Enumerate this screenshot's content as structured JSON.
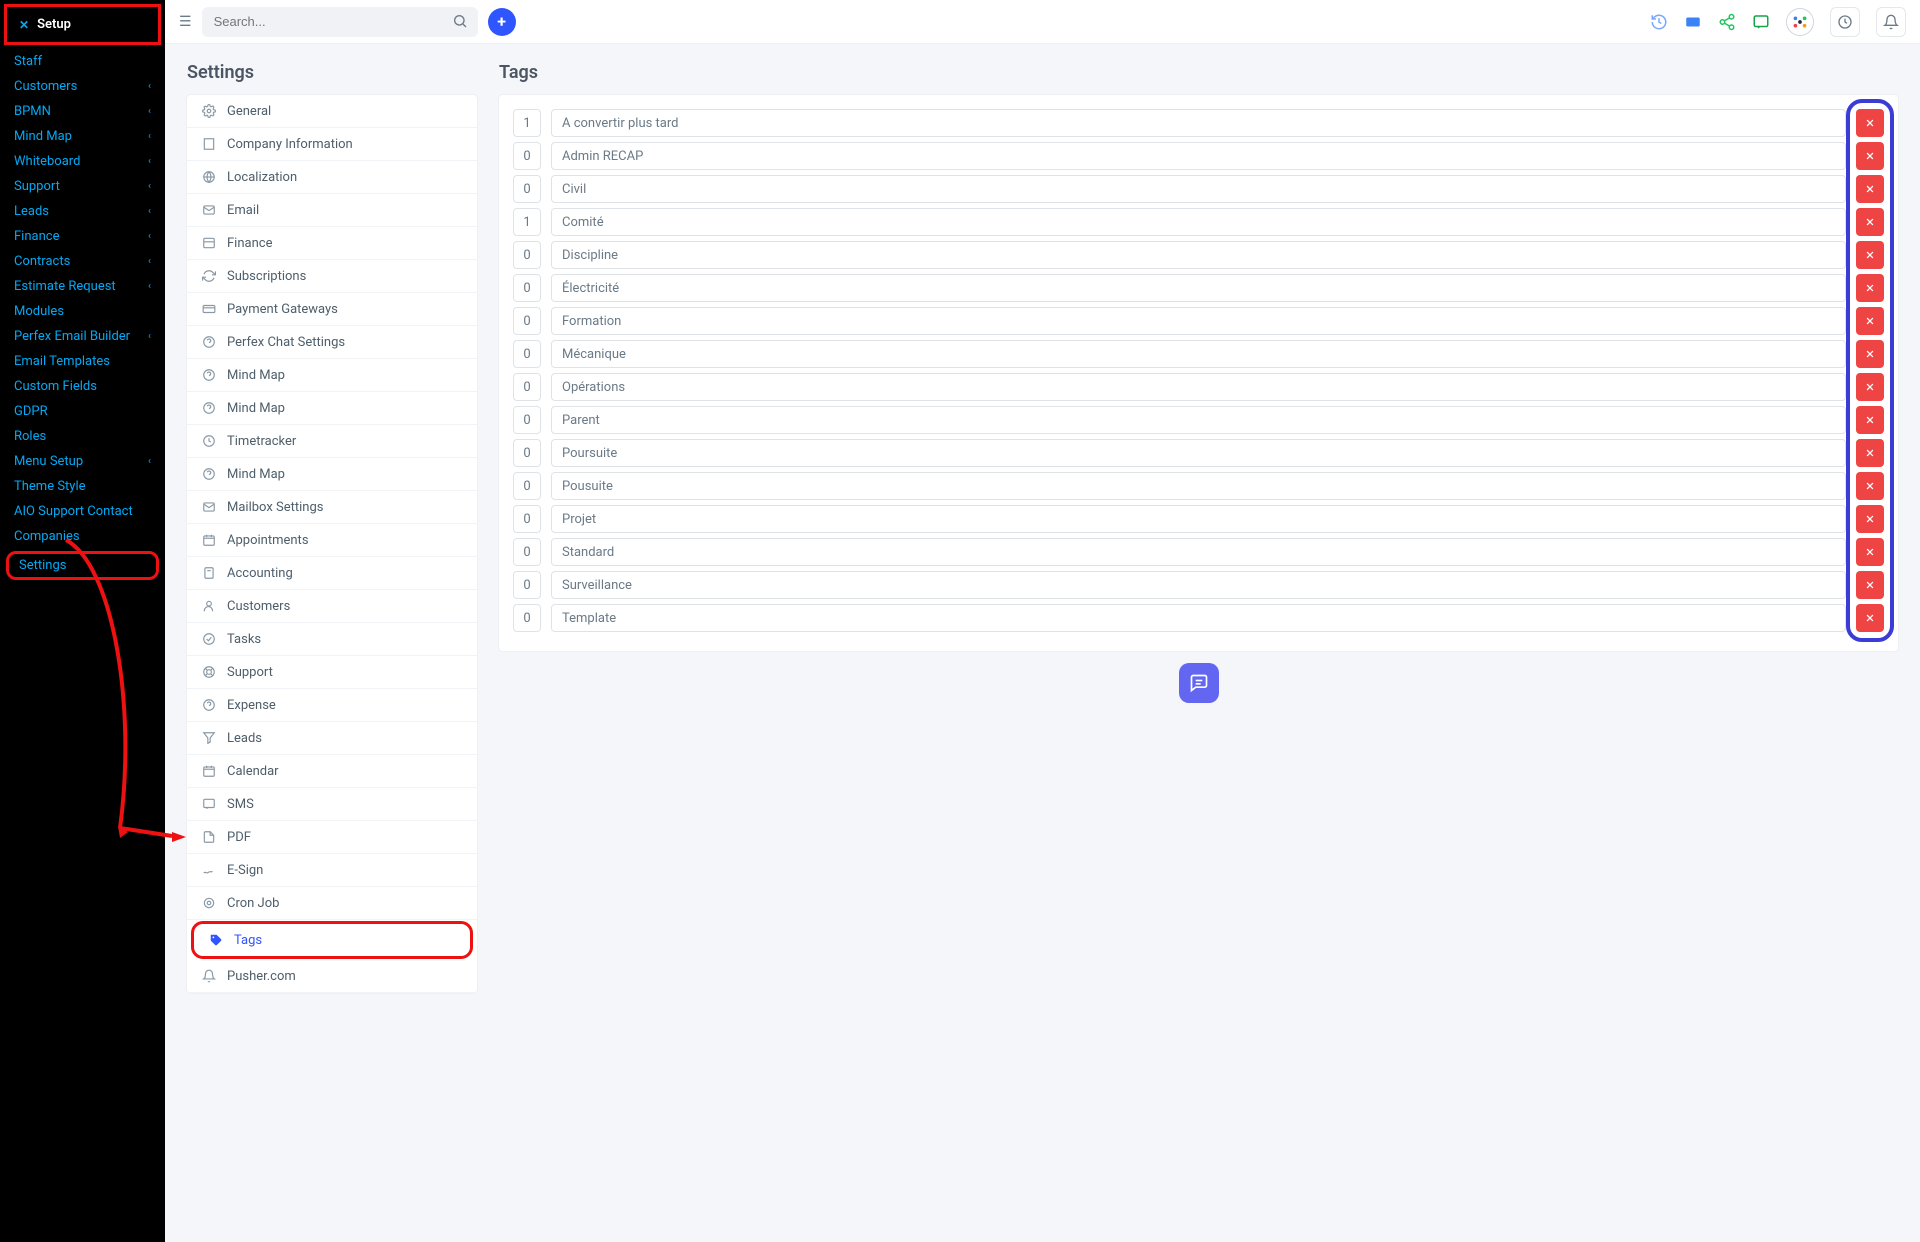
{
  "sidebar": {
    "title": "Setup",
    "items": [
      {
        "label": "Staff",
        "expandable": false
      },
      {
        "label": "Customers",
        "expandable": true
      },
      {
        "label": "BPMN",
        "expandable": true
      },
      {
        "label": "Mind Map",
        "expandable": true
      },
      {
        "label": "Whiteboard",
        "expandable": true
      },
      {
        "label": "Support",
        "expandable": true
      },
      {
        "label": "Leads",
        "expandable": true
      },
      {
        "label": "Finance",
        "expandable": true
      },
      {
        "label": "Contracts",
        "expandable": true
      },
      {
        "label": "Estimate Request",
        "expandable": true
      },
      {
        "label": "Modules",
        "expandable": false
      },
      {
        "label": "Perfex Email Builder",
        "expandable": true
      },
      {
        "label": "Email Templates",
        "expandable": false
      },
      {
        "label": "Custom Fields",
        "expandable": false
      },
      {
        "label": "GDPR",
        "expandable": false
      },
      {
        "label": "Roles",
        "expandable": false
      },
      {
        "label": "Menu Setup",
        "expandable": true
      },
      {
        "label": "Theme Style",
        "expandable": false
      },
      {
        "label": "AIO Support Contact",
        "expandable": false
      },
      {
        "label": "Companies",
        "expandable": false
      },
      {
        "label": "Settings",
        "expandable": false,
        "highlight": true
      }
    ]
  },
  "topbar": {
    "search_placeholder": "Search..."
  },
  "settings_panel": {
    "title": "Settings",
    "items": [
      {
        "icon": "gear",
        "label": "General"
      },
      {
        "icon": "building",
        "label": "Company Information"
      },
      {
        "icon": "globe",
        "label": "Localization"
      },
      {
        "icon": "mail",
        "label": "Email"
      },
      {
        "icon": "finance",
        "label": "Finance"
      },
      {
        "icon": "refresh",
        "label": "Subscriptions"
      },
      {
        "icon": "card",
        "label": "Payment Gateways"
      },
      {
        "icon": "help",
        "label": "Perfex Chat Settings"
      },
      {
        "icon": "help",
        "label": "Mind Map"
      },
      {
        "icon": "help",
        "label": "Mind Map"
      },
      {
        "icon": "clock",
        "label": "Timetracker"
      },
      {
        "icon": "help",
        "label": "Mind Map"
      },
      {
        "icon": "mail",
        "label": "Mailbox Settings"
      },
      {
        "icon": "calendar",
        "label": "Appointments"
      },
      {
        "icon": "calc",
        "label": "Accounting"
      },
      {
        "icon": "user",
        "label": "Customers"
      },
      {
        "icon": "check",
        "label": "Tasks"
      },
      {
        "icon": "lifebuoy",
        "label": "Support"
      },
      {
        "icon": "help",
        "label": "Expense"
      },
      {
        "icon": "leads",
        "label": "Leads"
      },
      {
        "icon": "calendar",
        "label": "Calendar"
      },
      {
        "icon": "sms",
        "label": "SMS"
      },
      {
        "icon": "pdf",
        "label": "PDF"
      },
      {
        "icon": "sign",
        "label": "E-Sign"
      },
      {
        "icon": "cron",
        "label": "Cron Job"
      },
      {
        "icon": "tag",
        "label": "Tags",
        "active": true,
        "highlight": true
      },
      {
        "icon": "bell",
        "label": "Pusher.com"
      }
    ]
  },
  "tags_panel": {
    "title": "Tags",
    "rows": [
      {
        "count": "1",
        "name": "A convertir plus tard"
      },
      {
        "count": "0",
        "name": "Admin RECAP"
      },
      {
        "count": "0",
        "name": "Civil"
      },
      {
        "count": "1",
        "name": "Comité"
      },
      {
        "count": "0",
        "name": "Discipline"
      },
      {
        "count": "0",
        "name": "Électricité"
      },
      {
        "count": "0",
        "name": "Formation"
      },
      {
        "count": "0",
        "name": "Mécanique"
      },
      {
        "count": "0",
        "name": "Opérations"
      },
      {
        "count": "0",
        "name": "Parent"
      },
      {
        "count": "0",
        "name": "Poursuite"
      },
      {
        "count": "0",
        "name": "Pousuite"
      },
      {
        "count": "0",
        "name": "Projet"
      },
      {
        "count": "0",
        "name": "Standard"
      },
      {
        "count": "0",
        "name": "Surveillance"
      },
      {
        "count": "0",
        "name": "Template"
      }
    ]
  },
  "colors": {
    "accent": "#2f55fe",
    "danger": "#ef4444",
    "link": "#03a9f4",
    "annotate": "#e11"
  }
}
